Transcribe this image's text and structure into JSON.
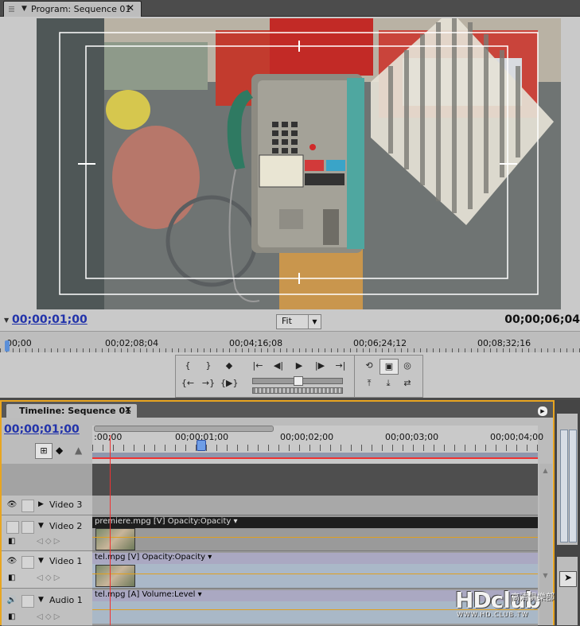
{
  "program_monitor": {
    "tab_title": "Program: Sequence 01",
    "current_timecode": "00;00;01;00",
    "duration_timecode": "00;00;06;04",
    "zoom": "Fit",
    "ruler_labels": [
      "00;00",
      "00;02;08;04",
      "00;04;16;08",
      "00;06;24;12",
      "00;08;32;16"
    ]
  },
  "transport": {
    "buttons": [
      {
        "name": "mark-in-button",
        "glyph": "{"
      },
      {
        "name": "mark-out-button",
        "glyph": "}"
      },
      {
        "name": "set-marker-button",
        "glyph": "◆"
      },
      {
        "name": "go-to-in-button",
        "glyph": "|←"
      },
      {
        "name": "step-back-button",
        "glyph": "◀|"
      },
      {
        "name": "play-button",
        "glyph": "▶"
      },
      {
        "name": "step-forward-button",
        "glyph": "|▶"
      },
      {
        "name": "go-to-out-button",
        "glyph": "→|"
      },
      {
        "name": "go-to-prev-edit-button",
        "glyph": "{←"
      },
      {
        "name": "go-to-next-edit-button",
        "glyph": "→}"
      },
      {
        "name": "play-in-to-out-button",
        "glyph": "{▶}"
      },
      {
        "name": "loop-button",
        "glyph": "⟲"
      },
      {
        "name": "safe-margins-button",
        "glyph": "▣"
      },
      {
        "name": "output-button",
        "glyph": "◎"
      },
      {
        "name": "lift-button",
        "glyph": "⤒"
      },
      {
        "name": "extract-button",
        "glyph": "⤓"
      },
      {
        "name": "trim-button",
        "glyph": "⇄"
      }
    ]
  },
  "timeline": {
    "tab_title": "Timeline: Sequence 01",
    "current_timecode": "00;00;01;00",
    "ruler_labels": [
      ":00;00",
      "00;00;01;00",
      "00;00;02;00",
      "00;00;03;00",
      "00;00;04;00"
    ],
    "tracks": [
      {
        "name": "Video 3",
        "clip": null
      },
      {
        "name": "Video 2",
        "clip": {
          "label": "premiere.mpg [V]",
          "effect": "Opacity:Opacity"
        }
      },
      {
        "name": "Video 1",
        "clip": {
          "label": "tel.mpg [V]",
          "effect": "Opacity:Opacity"
        }
      },
      {
        "name": "Audio 1",
        "clip": {
          "label": "tel.mpg [A]",
          "effect": "Volume:Level"
        }
      }
    ]
  },
  "watermark": {
    "logo": "HDclub",
    "chinese": "高清俱樂部",
    "url": "WWW.HD.CLUB.TW"
  },
  "colors": {
    "timecode_blue": "#2233aa",
    "panel_focus_orange": "#e8a520",
    "playhead_red": "#e33333"
  }
}
